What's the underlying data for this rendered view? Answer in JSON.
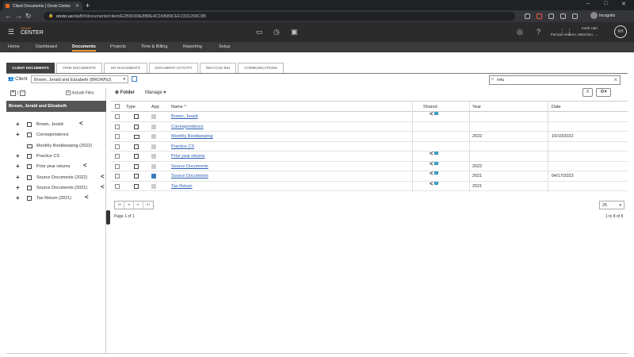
{
  "browser": {
    "tab_title": "Client Documents | Onvio Center",
    "url_host": "onvio.us",
    "url_path": "/staff/#/documents/client/E2B9D39E8B8E4CD6B89CEF2331200C9B",
    "profile": "Incognito"
  },
  "app": {
    "logo_small": "ONVIO",
    "logo_big": "CENTER",
    "user_name": "Keith Hart",
    "user_firm": "Parnas, Velarno, Marchino, ...",
    "user_initials": "KH"
  },
  "nav": [
    "Home",
    "Dashboard",
    "Documents",
    "Projects",
    "Time & Billing",
    "Reporting",
    "Setup"
  ],
  "subtabs": [
    "CLIENT DOCUMENTS",
    "FIRM DOCUMENTS",
    "MY DOCUMENTS",
    "DOCUMENT ACTIVITY",
    "RECYCLE BIN",
    "COMMUNICATIONS"
  ],
  "client": {
    "label": "Client",
    "selected": "Brown, Jerald and Elizabeth (BROWNJ)"
  },
  "search": {
    "value": "retu"
  },
  "left": {
    "tool_slash": "/",
    "include_files": "Include Files",
    "client_header": "Brown, Jerald and Elizabeth",
    "tree": [
      "Brown, Jerald",
      "Correspondence",
      "Monthly Bookkeeping (2022)",
      "Practice CS",
      "Prior year returns",
      "Source Documents (2022)",
      "Source Documents (2021)",
      "Tax Return (2021)"
    ]
  },
  "toolbar": {
    "folder": "Folder",
    "manage": "Manage"
  },
  "grid": {
    "headers": {
      "type": "Type",
      "app": "App",
      "name": "Name ^",
      "shared": "Shared",
      "year": "Year",
      "date": "Date"
    },
    "rows": [
      {
        "name": "Brown, Jerald",
        "shared": "1",
        "year": "",
        "date": ""
      },
      {
        "name": "Correspondence",
        "shared": "",
        "year": "",
        "date": ""
      },
      {
        "name": "Monthly Bookkeeping",
        "shared": "",
        "year": "2022",
        "date": "10/10/2022"
      },
      {
        "name": "Practice CS",
        "shared": "",
        "year": "",
        "date": ""
      },
      {
        "name": "Prior year returns",
        "shared": "1",
        "year": "",
        "date": ""
      },
      {
        "name": "Source Documents",
        "shared": "1",
        "year": "2022",
        "date": ""
      },
      {
        "name": "Source Documents",
        "shared": "1",
        "year": "2021",
        "date": "04/17/2023"
      },
      {
        "name": "Tax Return",
        "shared": "1",
        "year": "2021",
        "date": ""
      }
    ]
  },
  "pager": {
    "page_of": "Page 1 of 1",
    "count": "1 to 8 of 8",
    "page_size": "25"
  },
  "colors": {
    "accent": "#f39a3c",
    "header_bg": "#2b2b2b",
    "link": "#2a5db0",
    "share_badge": "#1f8fb8"
  }
}
